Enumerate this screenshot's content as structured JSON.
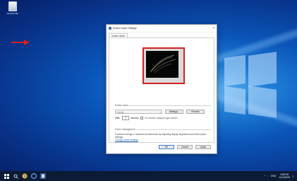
{
  "desktop": {
    "recycle_bin_label": "Recycle Bin"
  },
  "dialog": {
    "title": "Screen Saver Settings",
    "close_glyph": "×",
    "tab_label": "Screen Saver",
    "screensaver_group_label": "Screen saver",
    "screensaver_selected": "Mystify",
    "settings_button": "Settings...",
    "preview_button": "Preview",
    "wait_label": "Wait:",
    "wait_value": "1",
    "minutes_label": "minutes",
    "resume_label": "On resume, display logon screen",
    "power_group_label": "Power management",
    "power_description": "Conserve energy or maximize performance by adjusting display brightness and other power settings.",
    "power_link": "Change power settings",
    "ok_button": "OK",
    "cancel_button": "Cancel",
    "apply_button": "Apply"
  },
  "taskbar": {
    "time": "3:08 PM",
    "date": "11/14/2019",
    "lang": "ENG"
  },
  "colors": {
    "highlight": "#d42020",
    "taskbar": "#0b1a35"
  }
}
